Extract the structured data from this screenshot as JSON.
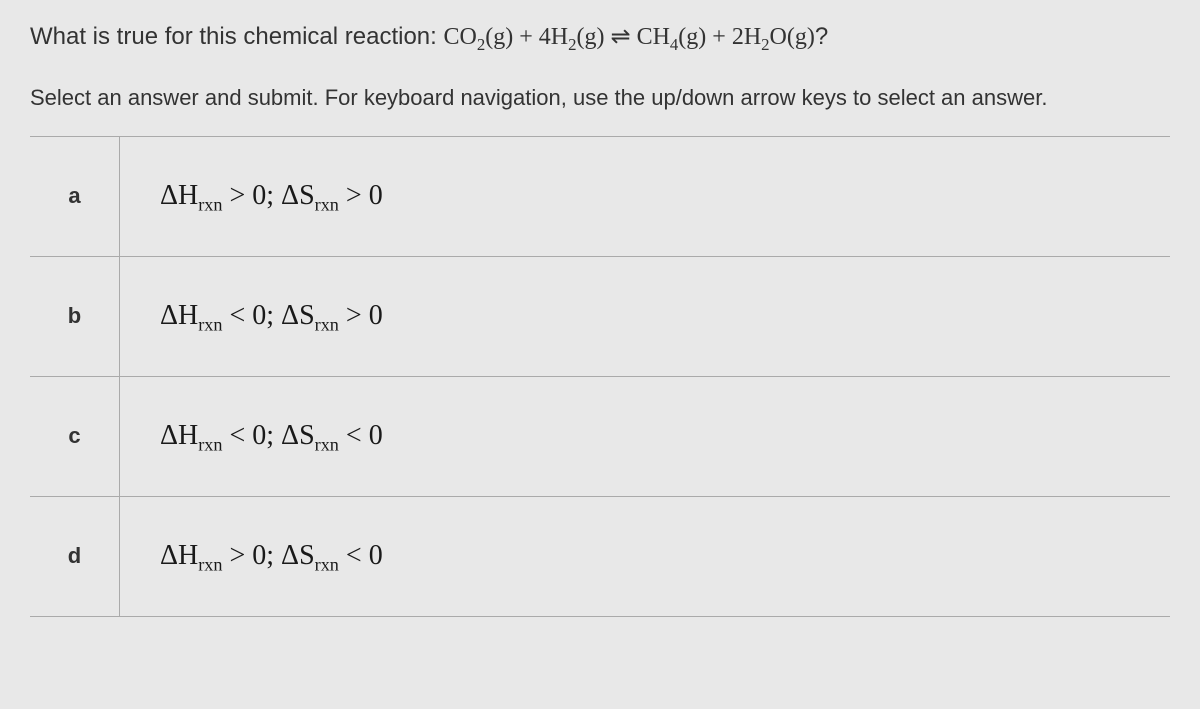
{
  "question": {
    "prefix": "What is true for this chemical reaction: ",
    "suffix": "?"
  },
  "instruction": "Select an answer and submit. For keyboard navigation, use the up/down arrow keys to select an answer.",
  "options": [
    {
      "letter": "a",
      "h_op": ">",
      "s_op": ">"
    },
    {
      "letter": "b",
      "h_op": "<",
      "s_op": ">"
    },
    {
      "letter": "c",
      "h_op": "<",
      "s_op": "<"
    },
    {
      "letter": "d",
      "h_op": ">",
      "s_op": "<"
    }
  ],
  "reaction": {
    "co2": "CO",
    "co2_sub": "2",
    "g": "(g)",
    "plus1": " + ",
    "h2_coef": "4H",
    "h2_sub": "2",
    "eq": " ⇌ ",
    "ch4": "CH",
    "ch4_sub": "4",
    "plus2": " + ",
    "h2o_coef": "2H",
    "h2o_sub": "2",
    "o": "O"
  }
}
